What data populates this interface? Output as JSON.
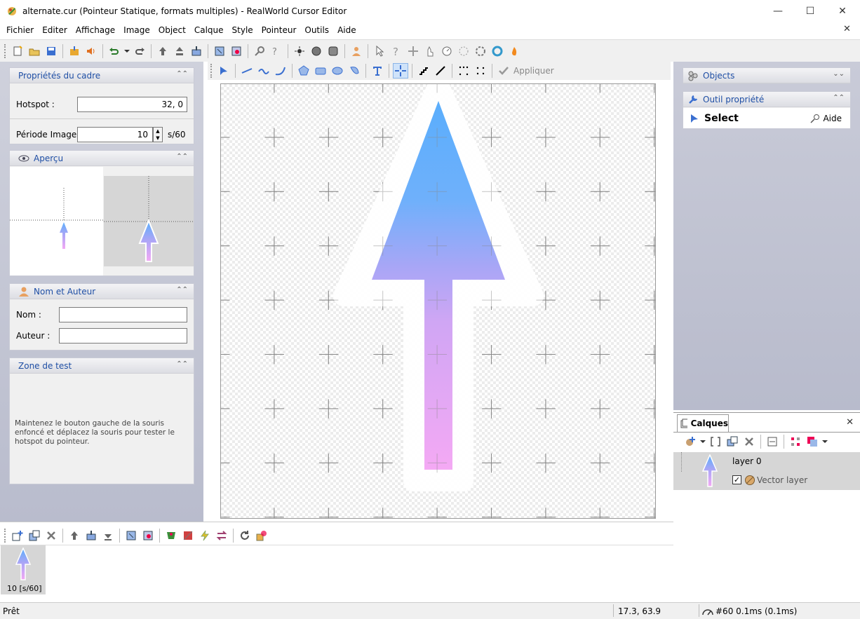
{
  "window": {
    "title": "alternate.cur (Pointeur Statique, formats multiples) - RealWorld Cursor Editor",
    "minimize": "—",
    "maximize": "☐",
    "close": "✕",
    "mdi_close": "✕"
  },
  "menu": [
    "Fichier",
    "Editer",
    "Affichage",
    "Image",
    "Object",
    "Calque",
    "Style",
    "Pointeur",
    "Outils",
    "Aide"
  ],
  "frame_props": {
    "title": "Propriétés du cadre",
    "hotspot_label": "Hotspot :",
    "hotspot_value": "32, 0",
    "period_label": "Période Image :",
    "period_value": "10",
    "period_unit": "s/60"
  },
  "preview": {
    "title": "Aperçu"
  },
  "author": {
    "title": "Nom et Auteur",
    "name_label": "Nom :",
    "name_value": "",
    "author_label": "Auteur :",
    "author_value": ""
  },
  "test_zone": {
    "title": "Zone de test",
    "hint": "Maintenez le bouton gauche de la souris enfoncé et déplacez la souris pour tester le hotspot du pointeur."
  },
  "draw_toolbar": {
    "apply_label": "Appliquer"
  },
  "right": {
    "objects_title": "Objects",
    "tool_prop_title": "Outil propriété",
    "select_label": "Select",
    "help_label": "Aide"
  },
  "layers": {
    "tab_label": "Calques",
    "layer_name": "layer 0",
    "layer_type": "Vector layer",
    "checked": true
  },
  "frames": {
    "frame_label": "10 [s/60]"
  },
  "status": {
    "ready": "Prêt",
    "coords": "17.3, 63.9",
    "timing": "#60 0.1ms (0.1ms)"
  },
  "colors": {
    "arrow_top": "#5aaefc",
    "arrow_mid": "#a8a6f6",
    "arrow_bottom": "#f4a9f4",
    "panel_title": "#1f4fa5",
    "panel_bg": "#c9cbd8"
  }
}
